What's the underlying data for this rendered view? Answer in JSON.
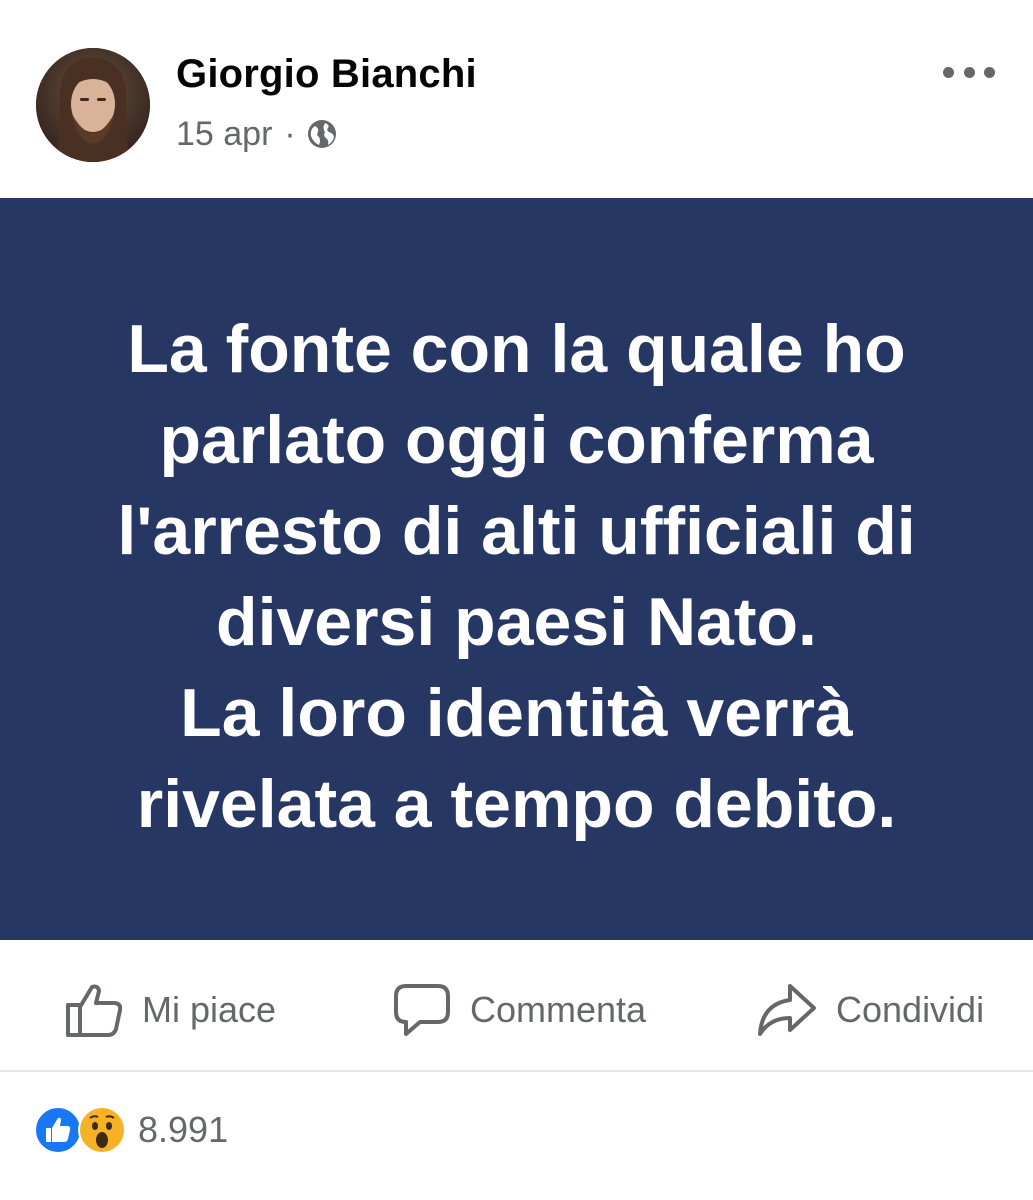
{
  "author": {
    "name": "Giorgio Bianchi",
    "date": "15 apr",
    "separator": "·",
    "privacy_icon": "globe-icon"
  },
  "post": {
    "background_color": "#263763",
    "text_color": "#ffffff",
    "lines": [
      "La fonte con la quale ho",
      "parlato oggi conferma",
      "l'arresto di alti ufficiali di",
      "diversi paesi Nato.",
      "La loro identità verrà",
      "rivelata a tempo debito."
    ]
  },
  "actions": {
    "like_label": "Mi piace",
    "comment_label": "Commenta",
    "share_label": "Condividi"
  },
  "reactions": {
    "icons": [
      "like-reaction-icon",
      "wow-reaction-icon"
    ],
    "count": "8.991"
  }
}
